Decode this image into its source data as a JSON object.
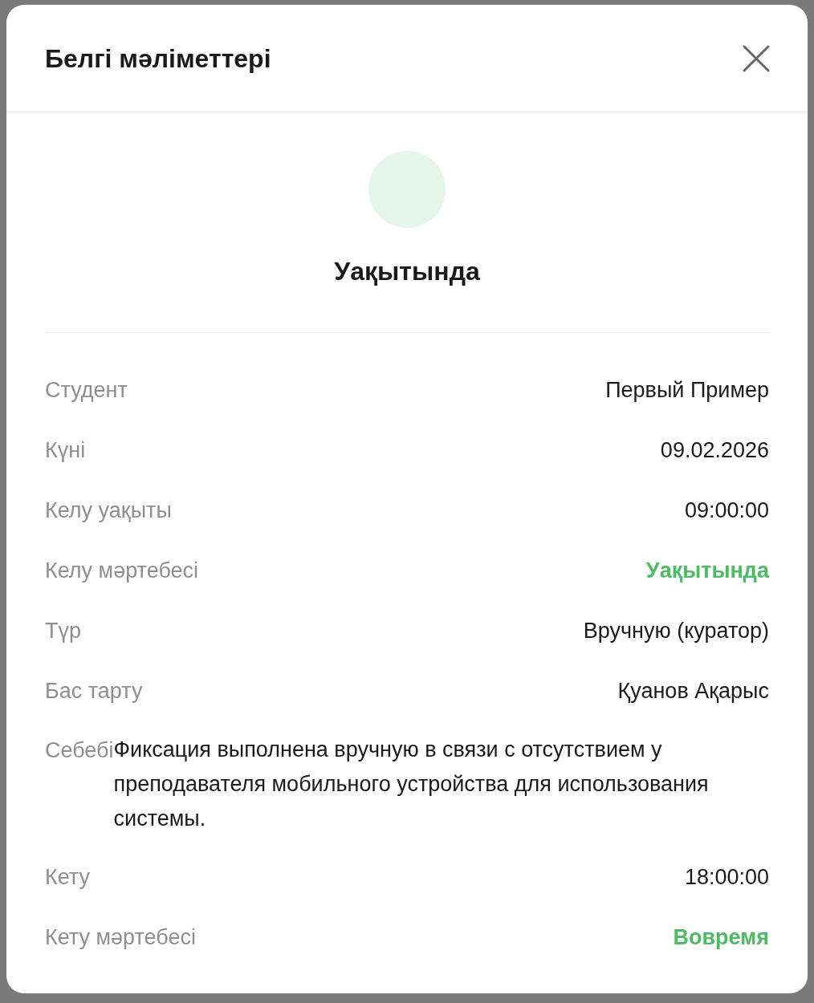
{
  "dialog": {
    "title": "Белгі мәліметтері"
  },
  "status": {
    "label": "Уақытында",
    "color": "#e6f5ea"
  },
  "details": [
    {
      "label": "Студент",
      "value": "Первый Пример",
      "kind": "text"
    },
    {
      "label": "Күні",
      "value": "09.02.2026",
      "kind": "text"
    },
    {
      "label": "Келу уақыты",
      "value": "09:00:00",
      "kind": "text"
    },
    {
      "label": "Келу мәртебесі",
      "value": "Уақытында",
      "kind": "status"
    },
    {
      "label": "Түр",
      "value": "Вручную (куратор)",
      "kind": "text"
    },
    {
      "label": "Бас тарту",
      "value": "Қуанов Ақарыс",
      "kind": "text"
    },
    {
      "label": "Себебі",
      "value": "Фиксация выполнена вручную в связи с отсутствием у преподавателя мобильного устройства для использования системы.",
      "kind": "note"
    },
    {
      "label": "Кету",
      "value": "18:00:00",
      "kind": "text"
    },
    {
      "label": "Кету мәртебесі",
      "value": "Вовремя",
      "kind": "status"
    }
  ]
}
